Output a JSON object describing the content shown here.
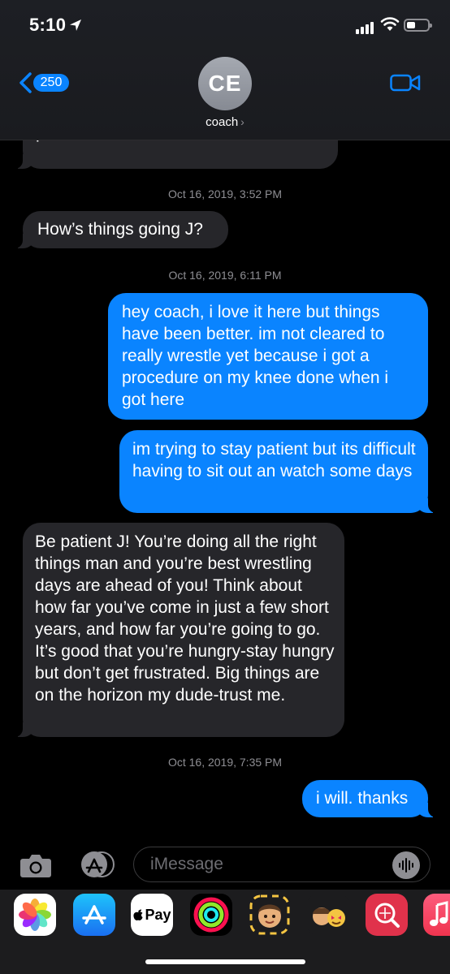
{
  "status_bar": {
    "time": "5:10"
  },
  "header": {
    "back_count": "250",
    "avatar_initials": "CE",
    "contact_name": "coach",
    "chevron": "›"
  },
  "messages": [
    {
      "dir": "in",
      "text": "plans"
    },
    {
      "timestamp": "Oct 16, 2019, 3:52 PM"
    },
    {
      "dir": "in",
      "text": "How’s things going J?"
    },
    {
      "timestamp": "Oct 16, 2019, 6:11 PM"
    },
    {
      "dir": "out",
      "text": "hey coach, i love it here but things have been better. im not cleared to really wrestle yet because i got a procedure on my knee done when i got here"
    },
    {
      "dir": "out",
      "text": "im trying to stay patient but its difficult having to sit out an watch some days"
    },
    {
      "dir": "in",
      "text": "Be patient J! You’re doing all the right things man and you’re best wrestling days are ahead of you! Think about how far you’ve come in just a few short years, and how far you’re going to go. It’s good that you’re hungry-stay hungry but don’t get frustrated. Big things are on the horizon my dude-trust me."
    },
    {
      "timestamp": "Oct 16, 2019, 7:35 PM"
    },
    {
      "dir": "out",
      "text": "i will. thanks"
    }
  ],
  "input": {
    "placeholder": "iMessage"
  },
  "app_drawer": {
    "apps": [
      "photos-icon",
      "app-store-icon",
      "apple-pay-icon",
      "activity-icon",
      "memoji-icon",
      "animoji-icon",
      "web-search-icon",
      "music-icon"
    ],
    "apple_pay_label": "Pay"
  },
  "colors": {
    "outgoing": "#0a84ff",
    "incoming": "#26262a",
    "accent": "#0a84ff"
  }
}
